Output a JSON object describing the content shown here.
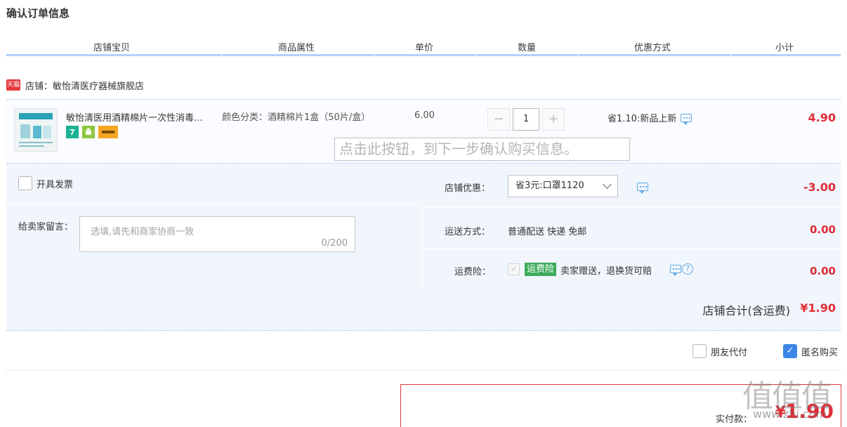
{
  "page": {
    "title": "确认订单信息"
  },
  "columns": [
    "店铺宝贝",
    "商品属性",
    "单价",
    "数量",
    "优惠方式",
    "小计"
  ],
  "shop": {
    "badge": "天猫",
    "label": "店铺：敏怡清医疗器械旗舰店"
  },
  "item": {
    "title": "敏怡清医用酒精棉片一次性消毒...",
    "attribute": "颜色分类：酒精棉片1盒（50片/盒）",
    "unit_price": "6.00",
    "quantity": "1",
    "minus": "−",
    "plus": "+",
    "promo": "省1.10:新品上新",
    "subtotal": "4.90",
    "service_icons": [
      "seven-day-return-icon",
      "android-icon",
      "credit-card-icon"
    ],
    "service_7_label": "7"
  },
  "tooltip": "点击此按钮，到下一步确认购买信息。",
  "options": {
    "invoice_label": "开具发票",
    "memo_label": "给卖家留言：",
    "memo_placeholder": "选填,请先和商家协商一致",
    "memo_count": "0/200",
    "shop_discount_label": "店铺优惠：",
    "shop_discount_value": "省3元:口罩1120",
    "shop_discount_amount": "-3.00",
    "shipping_label": "运送方式：",
    "shipping_text": "普通配送 快递 免邮",
    "shipping_amount": "0.00",
    "insurance_label": "运费险：",
    "insurance_tag": "运费险",
    "insurance_desc": "卖家赠送，退换货可赔",
    "insurance_amount": "0.00",
    "insurance_help": "?"
  },
  "totals": {
    "shop_total_label": "店铺合计(含运费)",
    "shop_total_value": "¥1.90"
  },
  "extras": {
    "friend_pay": "朋友代付",
    "anonymous": "匿名购买"
  },
  "payment": {
    "label": "实付款：",
    "currency": "¥",
    "value": "1.90"
  },
  "watermark": {
    "text": "值值值",
    "url": "www.zhi.com"
  },
  "colors": {
    "accent_red": "#e22c36",
    "header_line": "#b2d1ff",
    "panel_bg": "#f1f6fd",
    "checkbox_blue": "#3b86e7",
    "insurance_green": "#3cab5a"
  }
}
